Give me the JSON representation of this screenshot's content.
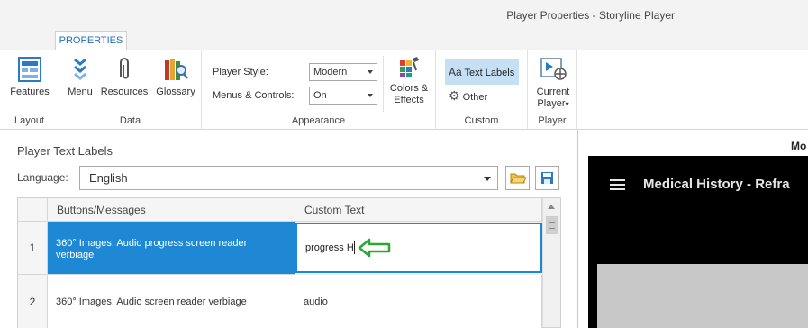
{
  "window": {
    "title": "Player Properties - Storyline Player"
  },
  "ribbon": {
    "tab": "PROPERTIES",
    "groups": {
      "layout": {
        "label": "Layout",
        "features": "Features"
      },
      "data": {
        "label": "Data",
        "menu": "Menu",
        "resources": "Resources",
        "glossary": "Glossary"
      },
      "appearance": {
        "label": "Appearance",
        "player_style_label": "Player Style:",
        "player_style_value": "Modern",
        "menus_controls_label": "Menus & Controls:",
        "menus_controls_value": "On",
        "colors_effects_line1": "Colors &",
        "colors_effects_line2": "Effects"
      },
      "custom": {
        "label": "Custom",
        "text_labels": "Text Labels",
        "other": "Other"
      },
      "player": {
        "label": "Player",
        "current_player_line1": "Current",
        "current_player_line2": "Player"
      }
    }
  },
  "panel": {
    "title": "Player Text Labels",
    "language_label": "Language:",
    "language_value": "English",
    "table": {
      "headers": [
        "Buttons/Messages",
        "Custom Text"
      ],
      "rows": [
        {
          "num": "1",
          "message_line1": "360° Images: Audio progress screen reader",
          "message_line2": "verbiage",
          "custom": "progress H"
        },
        {
          "num": "2",
          "message_line1": "360° Images: Audio screen reader verbiage",
          "message_line2": "",
          "custom": "audio"
        }
      ]
    }
  },
  "preview": {
    "header": "Mo",
    "title": "Medical History - Refra"
  },
  "colors": {
    "accent": "#1e88d4",
    "selected_row": "#1e88d4",
    "arrow": "#2aa832",
    "preview_bg": "#000000"
  }
}
